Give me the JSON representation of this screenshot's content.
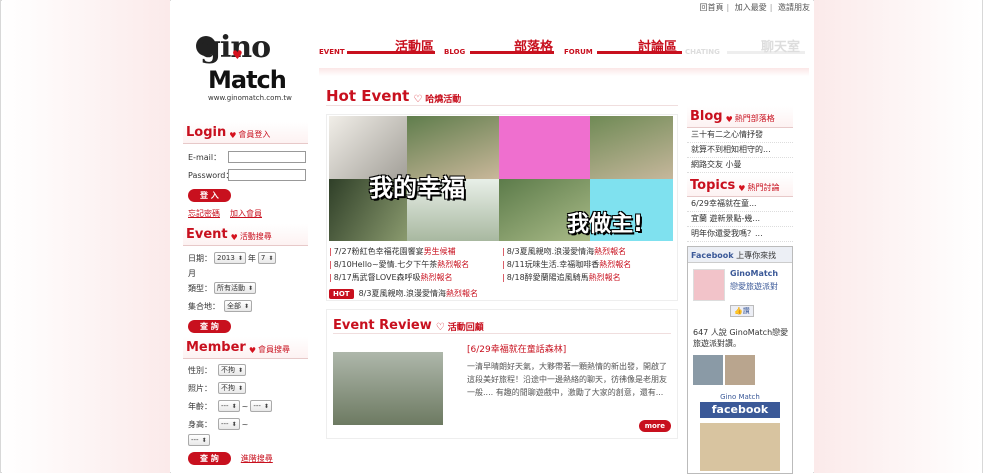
{
  "toplinks": [
    "回首頁",
    "加入最愛",
    "邀請朋友"
  ],
  "logo": {
    "top": "gino",
    "bottom": "Match",
    "url": "www.ginomatch.com.tw"
  },
  "nav": [
    {
      "en": "EVENT",
      "cn": "活動區",
      "active": true
    },
    {
      "en": "BLOG",
      "cn": "部落格",
      "active": true
    },
    {
      "en": "FORUM",
      "cn": "討論區",
      "active": true
    },
    {
      "en": "CHATING",
      "cn": "聊天室",
      "active": false
    }
  ],
  "login": {
    "title": "Login",
    "subtitle": "會員登入",
    "email_label": "E-mail：",
    "password_label": "Password：",
    "email_value": "",
    "password_value": "",
    "submit": "登 入",
    "forgot": "忘記密碼",
    "register": "加入會員"
  },
  "event_search": {
    "title": "Event",
    "subtitle": "活動搜尋",
    "date_label": "日期：",
    "year": "2013",
    "year_unit": "年",
    "month": "7",
    "month_unit": "月",
    "type_label": "類型：",
    "type_value": "所有活動",
    "place_label": "集合地：",
    "place_value": "全部",
    "submit": "查 詢"
  },
  "member_search": {
    "title": "Member",
    "subtitle": "會員搜尋",
    "gender_label": "性別：",
    "gender_value": "不拘",
    "photo_label": "照片：",
    "photo_value": "不拘",
    "age_label": "年齡：",
    "age_from": "---",
    "age_to": "---",
    "range_sep": "~",
    "height_label": "身高：",
    "height_from": "---",
    "height_to": "---",
    "submit": "查 詢",
    "advanced": "進階搜尋"
  },
  "hot_event": {
    "title": "Hot Event",
    "subtitle": "哈燒活動",
    "banner_text_1": "我的幸福",
    "banner_text_2": "我做主!",
    "events_left": [
      {
        "text": "7/27粉紅色幸福花園饗宴",
        "hl": "男生候補"
      },
      {
        "text": "8/10Hello~愛情.七夕下午茶",
        "hl": "熱烈報名"
      },
      {
        "text": "8/17馬武督LOVE森呼吸",
        "hl": "熱烈報名"
      }
    ],
    "events_right": [
      {
        "text": "8/3夏風親吻.浪漫愛情海",
        "hl": "熱烈報名"
      },
      {
        "text": "8/11玩味生活.幸福咖啡香",
        "hl": "熱烈報名"
      },
      {
        "text": "8/18醉愛蘭陽追風騎馬",
        "hl": "熱烈報名"
      }
    ],
    "hot_badge": "HOT",
    "hot_text": "8/3夏風親吻.浪漫愛情海",
    "hot_hl": "熱烈報名"
  },
  "review": {
    "title": "Event Review",
    "subtitle": "活動回顧",
    "article_title": "[6/29幸福就在童話森林]",
    "article_text": "一清早晴朗好天氣，大夥帶著一顆熱情的新出發，開啟了這段美好旅程！沿途中一邊熱絡的聊天，彷彿像是老朋友一般.... 有趣的閒聊遊戲中，激勵了大家的創意，還有...",
    "more": "more"
  },
  "blog": {
    "title": "Blog",
    "subtitle": "熱門部落格",
    "items": [
      "三十有二之心情抒發",
      "就算不到相知相守的...",
      "網路交友 小曼"
    ]
  },
  "topics": {
    "title": "Topics",
    "subtitle": "熱門討論",
    "items": [
      "6/29幸福就在童...",
      "宜蘭 遊新景點-幾...",
      "明年你還愛我嗎？..."
    ]
  },
  "facebook": {
    "header_brand": "Facebook",
    "header_text": "上專你來找",
    "page_name": "GinoMatch",
    "page_sub": "戀愛旅遊派對",
    "like": "讚",
    "count_text": "647 人說 GinoMatch戀愛旅遊派對讚。",
    "footer_name": "Gino Match",
    "footer_logo": "facebook"
  }
}
